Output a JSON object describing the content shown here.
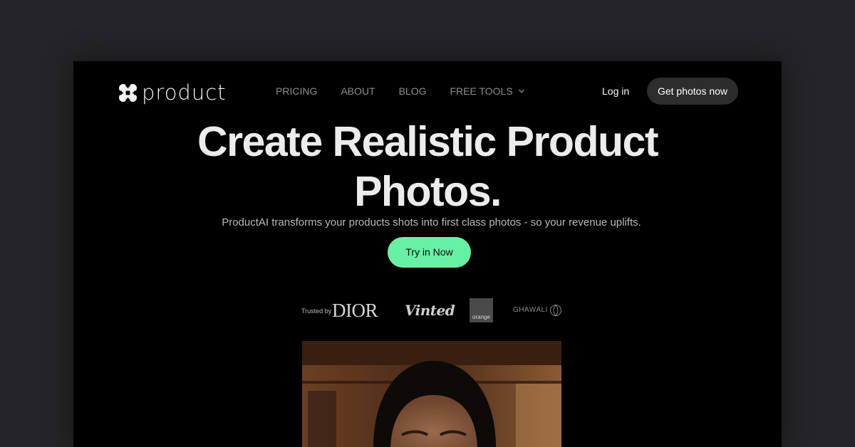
{
  "brand": {
    "name": "product",
    "logo_icon": "clover-cross-icon"
  },
  "nav": {
    "items": [
      {
        "label": "PRICING"
      },
      {
        "label": "ABOUT"
      },
      {
        "label": "BLOG"
      },
      {
        "label": "FREE TOOLS",
        "icon": "chevron-down-icon"
      }
    ]
  },
  "header": {
    "login_label": "Log in",
    "cta_label": "Get photos now"
  },
  "hero": {
    "title": "Create Realistic Product Photos.",
    "subtitle": "ProductAI transforms your products shots into first class photos - so your revenue uplifts.",
    "cta_label": "Try in Now"
  },
  "trusted": {
    "label": "Trusted by",
    "brands": [
      "DIOR",
      "Vinted",
      "orange",
      "GHAWALI"
    ]
  },
  "colors": {
    "page_background": "#252529",
    "frame_background": "#000000",
    "accent": "#68f0a5",
    "nav_text": "#8d8d8d",
    "pill_dark": "#2d2d2d"
  }
}
